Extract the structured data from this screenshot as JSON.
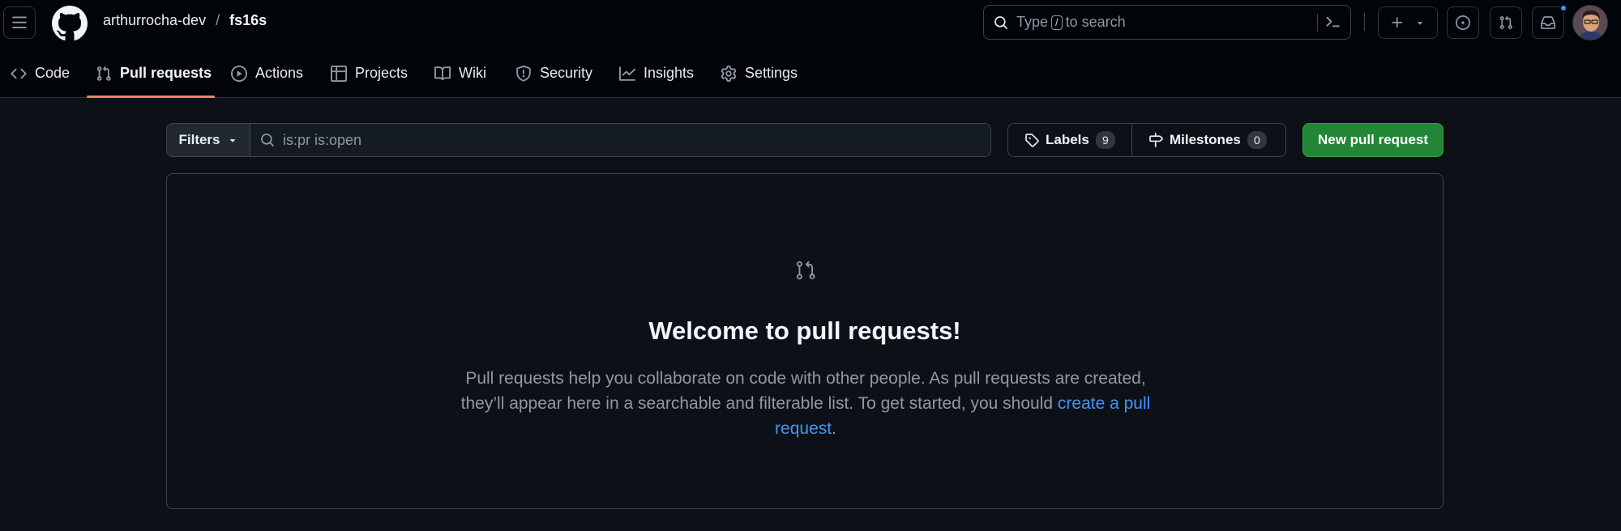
{
  "header": {
    "owner": "arthurrocha-dev",
    "separator": "/",
    "repo": "fs16s",
    "search": {
      "prefix": "Type",
      "key": "/",
      "suffix": "to search"
    }
  },
  "tabs": [
    {
      "label": "Code",
      "icon": "code-icon"
    },
    {
      "label": "Pull requests",
      "icon": "git-pull-request-icon",
      "selected": true
    },
    {
      "label": "Actions",
      "icon": "play-icon"
    },
    {
      "label": "Projects",
      "icon": "table-icon"
    },
    {
      "label": "Wiki",
      "icon": "book-icon"
    },
    {
      "label": "Security",
      "icon": "shield-icon"
    },
    {
      "label": "Insights",
      "icon": "graph-icon"
    },
    {
      "label": "Settings",
      "icon": "gear-icon"
    }
  ],
  "subnav": {
    "filters_label": "Filters",
    "query": "is:pr is:open",
    "labels_label": "Labels",
    "labels_count": "9",
    "milestones_label": "Milestones",
    "milestones_count": "0",
    "new_pr_label": "New pull request"
  },
  "blankslate": {
    "title": "Welcome to pull requests!",
    "desc_before_link": "Pull requests help you collaborate on code with other people. As pull requests are created, they’ll appear here in a searchable and filterable list. To get started, you should ",
    "link_text": "create a pull request",
    "desc_after_link": "."
  },
  "colors": {
    "background": "#0d1117",
    "header_background": "#010409",
    "accent_underline": "#f78166",
    "primary_button": "#238636",
    "link": "#4493f8"
  }
}
